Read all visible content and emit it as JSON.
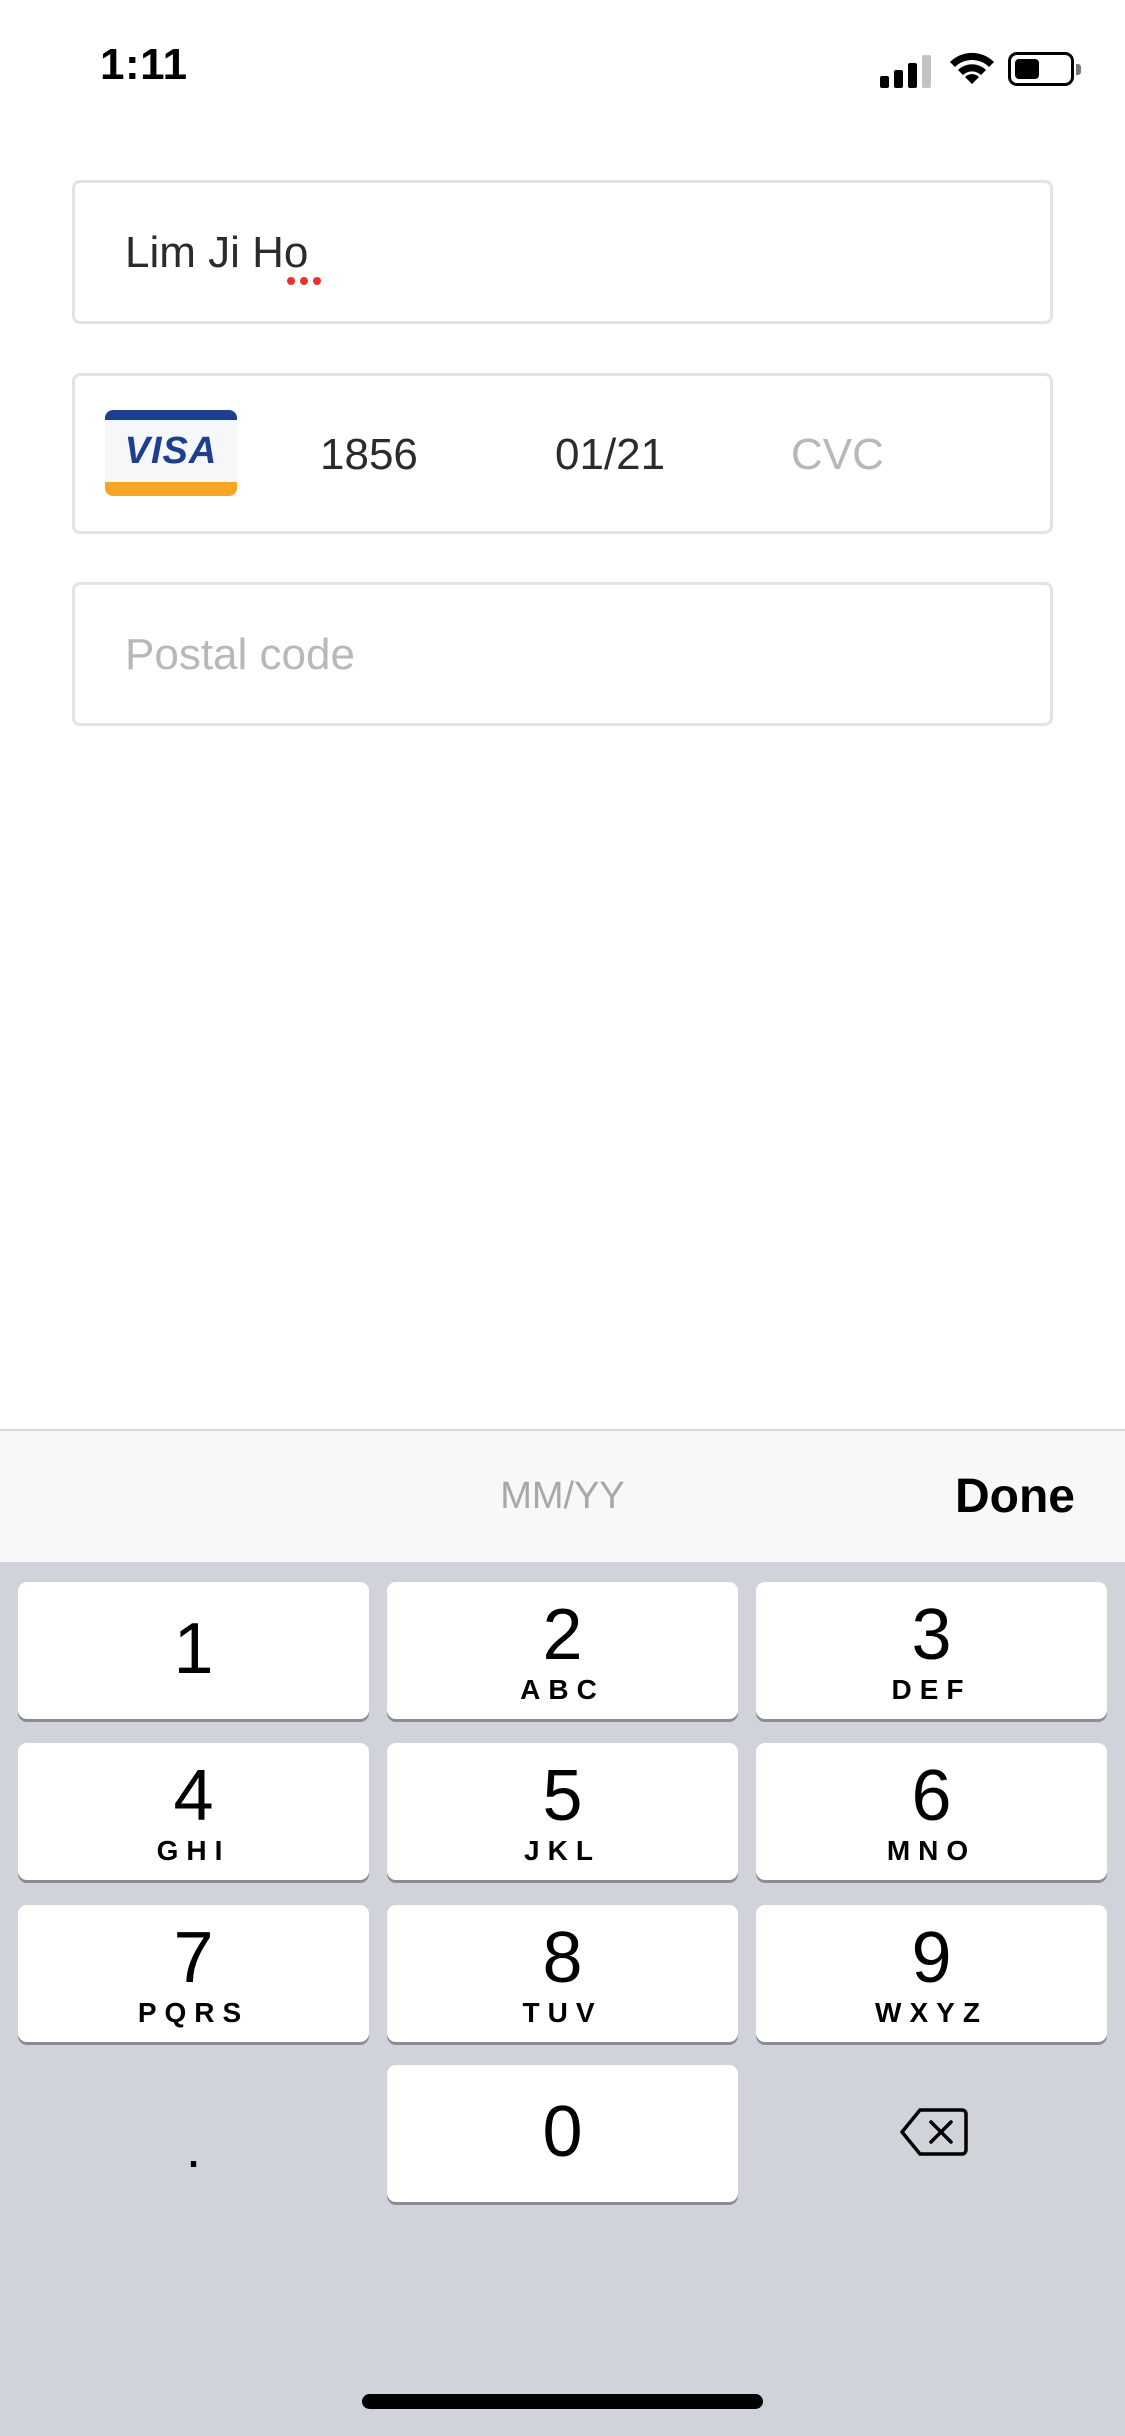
{
  "status_bar": {
    "time": "1:11",
    "icons": [
      "cellular-signal-icon",
      "wifi-icon",
      "battery-icon"
    ]
  },
  "form": {
    "name_value": "Lim Ji Ho",
    "card": {
      "brand": "VISA",
      "last4": "1856",
      "expiry": "01/21",
      "cvc_placeholder": "CVC",
      "brand_colors": {
        "blue": "#1e3f8f",
        "gold": "#f6a623"
      }
    },
    "postal_placeholder": "Postal code"
  },
  "keyboard_toolbar": {
    "format_hint": "MM/YY",
    "done_label": "Done"
  },
  "keyboard": {
    "keys": [
      {
        "digit": "1",
        "letters": ""
      },
      {
        "digit": "2",
        "letters": "ABC"
      },
      {
        "digit": "3",
        "letters": "DEF"
      },
      {
        "digit": "4",
        "letters": "GHI"
      },
      {
        "digit": "5",
        "letters": "JKL"
      },
      {
        "digit": "6",
        "letters": "MNO"
      },
      {
        "digit": "7",
        "letters": "PQRS"
      },
      {
        "digit": "8",
        "letters": "TUV"
      },
      {
        "digit": "9",
        "letters": "WXYZ"
      },
      {
        "digit": "0",
        "letters": ""
      }
    ],
    "decimal_label": ".",
    "delete_icon": "backspace-icon"
  },
  "colors": {
    "spell_error": "#e8322b",
    "keyboard_background": "#d1d3da"
  }
}
